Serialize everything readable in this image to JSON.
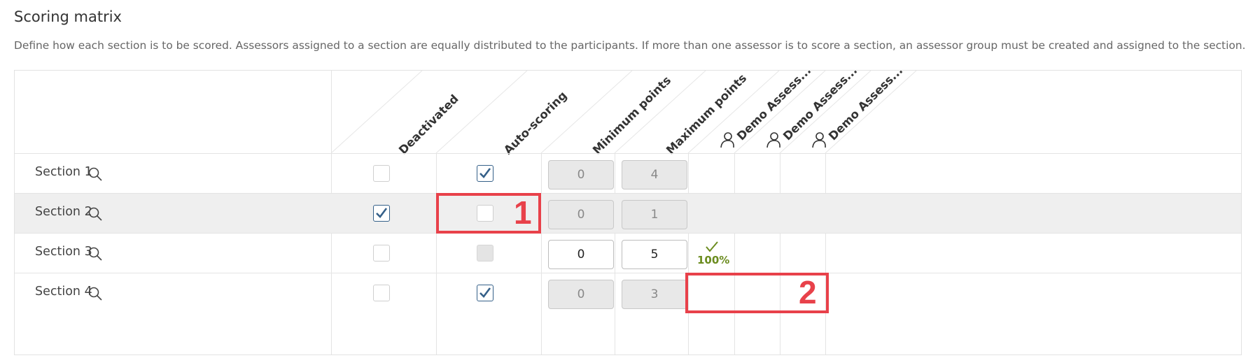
{
  "title": "Scoring matrix",
  "description": "Define how each section is to be scored. Assessors assigned to a section are equally distributed to the participants. If more than one assessor is to score a section, an assessor group must be created and assigned to the section.",
  "columns": {
    "deactivated": "Deactivated",
    "auto_scoring": "Auto-scoring",
    "minimum_points": "Minimum points",
    "maximum_points": "Maximum points",
    "assessor_1": "Demo Assess...",
    "assessor_2": "Demo Assess...",
    "assessor_3": "Demo Assess..."
  },
  "sections": [
    {
      "label": "Section 1",
      "deactivated": false,
      "auto_scoring": true,
      "auto_scoring_disabled": false,
      "min": "0",
      "max": "4",
      "editable": false
    },
    {
      "label": "Section 2",
      "deactivated": true,
      "auto_scoring": false,
      "auto_scoring_disabled": false,
      "min": "0",
      "max": "1",
      "editable": false
    },
    {
      "label": "Section 3",
      "deactivated": false,
      "auto_scoring": false,
      "auto_scoring_disabled": true,
      "min": "0",
      "max": "5",
      "editable": true,
      "assessor_1_progress": "100%"
    },
    {
      "label": "Section 4",
      "deactivated": false,
      "auto_scoring": true,
      "auto_scoring_disabled": false,
      "min": "0",
      "max": "3",
      "editable": false
    }
  ],
  "annotations": {
    "one": "1",
    "two": "2"
  },
  "colors": {
    "accent": "#356089",
    "annotation": "#e8414a",
    "success": "#6b8c1f"
  }
}
